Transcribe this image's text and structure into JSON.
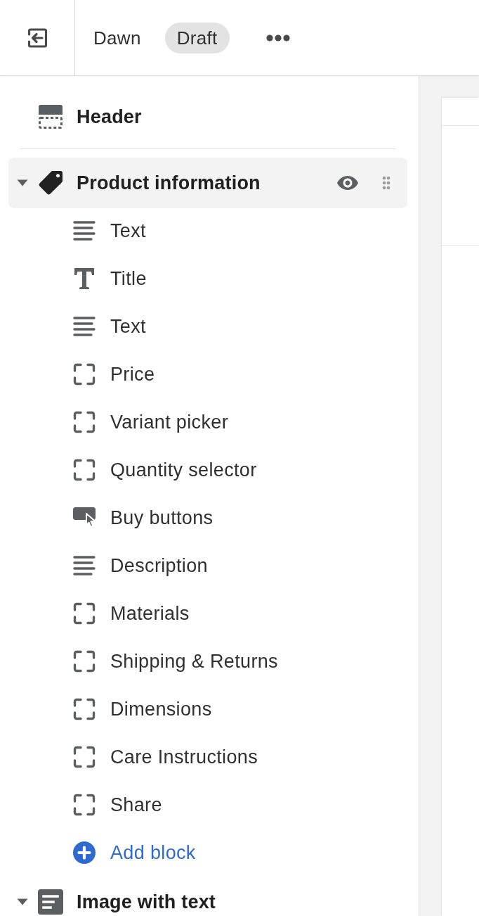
{
  "top_bar": {
    "theme_name": "Dawn",
    "status": "Draft"
  },
  "sections": [
    {
      "kind": "header",
      "title": "Header",
      "selected": false
    },
    {
      "kind": "product",
      "title": "Product information",
      "selected": true,
      "expanded": true,
      "blocks": [
        {
          "kind": "text",
          "label": "Text"
        },
        {
          "kind": "title",
          "label": "Title"
        },
        {
          "kind": "text",
          "label": "Text"
        },
        {
          "kind": "placeholder",
          "label": "Price"
        },
        {
          "kind": "placeholder",
          "label": "Variant picker"
        },
        {
          "kind": "placeholder",
          "label": "Quantity selector"
        },
        {
          "kind": "buy",
          "label": "Buy buttons"
        },
        {
          "kind": "text",
          "label": "Description"
        },
        {
          "kind": "placeholder",
          "label": "Materials"
        },
        {
          "kind": "placeholder",
          "label": "Shipping & Returns"
        },
        {
          "kind": "placeholder",
          "label": "Dimensions"
        },
        {
          "kind": "placeholder",
          "label": "Care Instructions"
        },
        {
          "kind": "placeholder",
          "label": "Share"
        }
      ],
      "add_block": "Add block"
    },
    {
      "kind": "image_text",
      "title": "Image with text",
      "selected": false,
      "expanded": true
    }
  ]
}
